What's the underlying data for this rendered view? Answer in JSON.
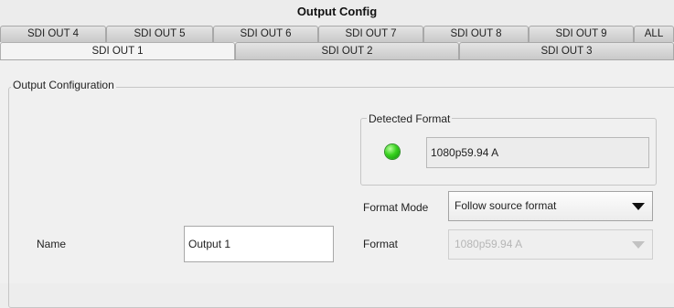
{
  "window": {
    "title": "Output Config"
  },
  "tabs_back": [
    "SDI OUT 4",
    "SDI OUT 5",
    "SDI OUT 6",
    "SDI OUT 7",
    "SDI OUT 8",
    "SDI OUT 9",
    "ALL"
  ],
  "tabs_front": [
    "SDI OUT 1",
    "SDI OUT 2",
    "SDI OUT 3"
  ],
  "selected_tab": "SDI OUT 1",
  "output_configuration": {
    "legend": "Output Configuration",
    "detected_format": {
      "legend": "Detected Format",
      "value": "1080p59.94 A",
      "status_led_color": "#2fc81a"
    },
    "format_mode": {
      "label": "Format Mode",
      "value": "Follow source format"
    },
    "name": {
      "label": "Name",
      "value": "Output 1"
    },
    "format": {
      "label": "Format",
      "value": "1080p59.94 A",
      "enabled": false
    }
  }
}
